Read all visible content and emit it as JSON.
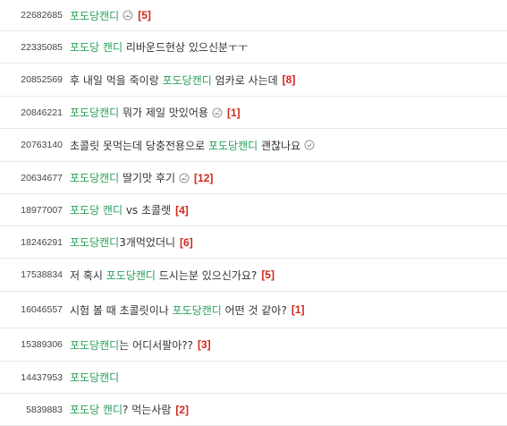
{
  "posts": [
    {
      "id": "22682685",
      "title": [
        "포도당캔디"
      ],
      "reply": "[5]",
      "icon": "image-icon"
    },
    {
      "id": "22335085",
      "title": [
        "포도당 캔디",
        " 리바운드현상 있으신분ㅜㅜ"
      ],
      "reply": "",
      "icon": ""
    },
    {
      "id": "20852569",
      "title": [
        "후 내일 먹을 죽이랑 ",
        "포도당캔디",
        " 엄카로 사는데"
      ],
      "reply": "[8]",
      "icon": ""
    },
    {
      "id": "20846221",
      "title": [
        "포도당캔디",
        " 뭐가 제일 맛있어용"
      ],
      "reply": "[1]",
      "icon": "image-icon"
    },
    {
      "id": "20763140",
      "title": [
        "초콜릿 못먹는데 당충전용으로 ",
        "포도당캔디",
        " 괜찮나요"
      ],
      "reply": "",
      "icon": "check-icon"
    },
    {
      "id": "20634677",
      "title": [
        "포도당캔디",
        " 딸기맛 후기"
      ],
      "reply": "[12]",
      "icon": "image-icon"
    },
    {
      "id": "18977007",
      "title": [
        "포도당 캔디",
        " vs 초콜렛"
      ],
      "reply": "[4]",
      "icon": ""
    },
    {
      "id": "18246291",
      "title": [
        "포도당캔디",
        "3개먹었더니"
      ],
      "reply": "[6]",
      "icon": ""
    },
    {
      "id": "17538834",
      "title": [
        "저 혹시 ",
        "포도당캔디",
        " 드시는분 있으신가요?"
      ],
      "reply": "[5]",
      "icon": ""
    },
    {
      "id": "16046557",
      "title": [
        "시험 볼 때 초콜릿이나 ",
        "포도당캔디",
        " 어떤 것 같아?"
      ],
      "reply": "[1]",
      "icon": ""
    },
    {
      "id": "15389306",
      "title": [
        "포도당캔디",
        "는 어디서팔아??"
      ],
      "reply": "[3]",
      "icon": ""
    },
    {
      "id": "14437953",
      "title": [
        "포도당캔디"
      ],
      "reply": "",
      "icon": ""
    },
    {
      "id": "5839883",
      "title": [
        "포도당 캔디",
        "? 먹는사람"
      ],
      "reply": "[2]",
      "icon": ""
    }
  ],
  "highlight_color": "#2aa05a",
  "reply_color": "#d0271b"
}
